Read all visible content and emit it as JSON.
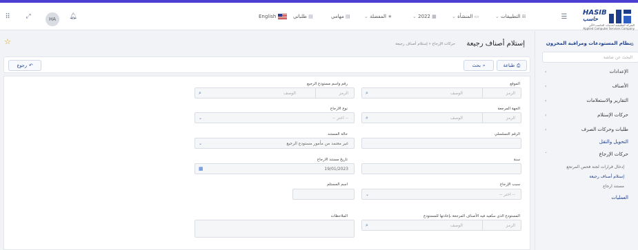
{
  "topbar": {
    "avatar_initials": "HA",
    "language": "English",
    "nav": [
      {
        "label": "التطبيقات",
        "icon": "grid-icon"
      },
      {
        "label": "المنشأة",
        "icon": "building-icon"
      },
      {
        "label": "2022",
        "icon": "calendar-icon"
      },
      {
        "label": "المفضلة",
        "icon": "star-icon"
      },
      {
        "label": "مهامي",
        "icon": "tasks-icon"
      },
      {
        "label": "طلباتي",
        "icon": "requests-icon"
      }
    ],
    "logo_text": "HASIB",
    "logo_arabic": "حاسب",
    "logo_company_ar": "الشركة التطبيقية لخدمات الحاسب الآلي",
    "logo_company_en": "Applied Computer Services Company"
  },
  "sidebar": {
    "title": "نظام المستودعات ومراقبة المخزون",
    "search_placeholder": "البحث عن شاشة",
    "items": [
      {
        "label": "الإعدادات"
      },
      {
        "label": "الأصناف"
      },
      {
        "label": "التقارير والاستعلامات"
      },
      {
        "label": "حركات الإستلام"
      },
      {
        "label": "طلبات وحركات الصرف"
      },
      {
        "label": "التحويل والنقل"
      },
      {
        "label": "حركات الإرجاع"
      }
    ],
    "subitems": [
      {
        "label": "إدخال قرارات لجنة فحص المرتجع"
      },
      {
        "label": "إستلام أصناف رجيعة"
      },
      {
        "label": "مستند ارجاع"
      }
    ],
    "last_item": "العمليات"
  },
  "page": {
    "title": "إستلام أصناف رجيعة",
    "breadcrumb": "حركات الإرجاع « إستلام أصناف رجيعة",
    "print_label": "طباعة",
    "search_label": "بحث",
    "back_label": "رجوع"
  },
  "form": {
    "location_label": "الموقع",
    "warehouse_label": "رقم واسم مستودع الرجيع",
    "ref_label": "الجهة المرجعة",
    "return_type_label": "نوع الارجاع",
    "serial_label": "الرقم التسلسلي",
    "doc_status_label": "حالة المستند",
    "year_label": "سنة",
    "doc_date_label": "تاريخ مستند الارجاع",
    "reason_label": "سبب الإرجاع",
    "receiver_label": "اسم المستلم",
    "target_warehouse_label": "المستودع الذي ستُقيد فيه الأصناف المرجعة بإعادتها للمستودع",
    "notes_label": "الملاحظات",
    "code_ph": "الرمز",
    "desc_ph": "الوصف",
    "select_ph": "-- اختر --",
    "doc_status_value": "غير معتمد من مأمور مستودع الرجيع",
    "doc_date_value": "19/01/2023"
  }
}
